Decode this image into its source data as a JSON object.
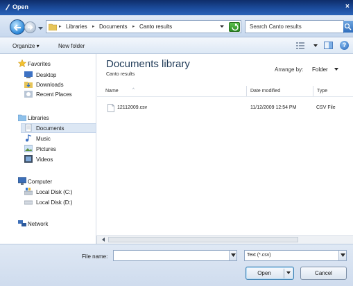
{
  "window": {
    "title": "Open",
    "close_glyph": "×"
  },
  "address": {
    "crumbs": [
      "Libraries",
      "Documents",
      "Canto results"
    ],
    "separator": "▸",
    "search_placeholder": "Search Canto results"
  },
  "toolbar": {
    "organize_label": "Organize ▾",
    "new_folder_label": "New folder",
    "help_glyph": "?"
  },
  "navpane": {
    "favorites": {
      "label": "Favorites",
      "items": [
        "Desktop",
        "Downloads",
        "Recent Places"
      ]
    },
    "libraries": {
      "label": "Libraries",
      "items": [
        "Documents",
        "Music",
        "Pictures",
        "Videos"
      ],
      "selected": "Documents"
    },
    "computer": {
      "label": "Computer",
      "items": [
        "Local Disk (C:)",
        "Local Disk (D:)"
      ]
    },
    "network": {
      "label": "Network"
    }
  },
  "library": {
    "title": "Documents library",
    "subtitle": "Canto results",
    "arrange_label": "Arrange by:",
    "arrange_value": "Folder"
  },
  "columns": {
    "name": "Name",
    "date": "Date modified",
    "type": "Type"
  },
  "files": [
    {
      "name": "12112009.csv",
      "date": "11/12/2009 12:54 PM",
      "type": "CSV File"
    }
  ],
  "footer": {
    "file_name_label": "File name:",
    "file_name_value": "",
    "file_type_value": "Text (*.csv)",
    "open_label": "Open",
    "cancel_label": "Cancel"
  },
  "colors": {
    "title_bar": "#1d4fa0",
    "selection": "#dce7f4",
    "header_text": "#1e3956"
  }
}
